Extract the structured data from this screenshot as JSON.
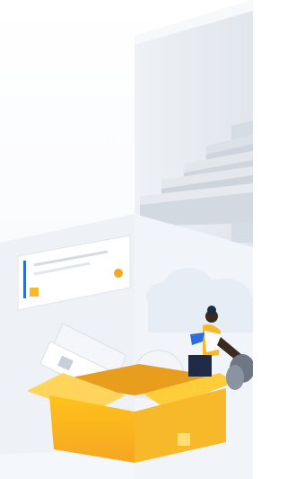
{
  "illustration": {
    "name": "onboarding-illustration",
    "icons": [
      "staircase-icon",
      "card-icon",
      "box-icon",
      "person-icon",
      "cloud-icon",
      "paper-icon",
      "clock-icon"
    ],
    "colors": {
      "accent_yellow": "#F7B829",
      "box_orange": "#F5A623",
      "card_blue": "#2D6CDF",
      "wall_gray": "#E9EDF2",
      "stair_gray": "#D9DEE5",
      "sky": "#F3F6FA"
    }
  }
}
